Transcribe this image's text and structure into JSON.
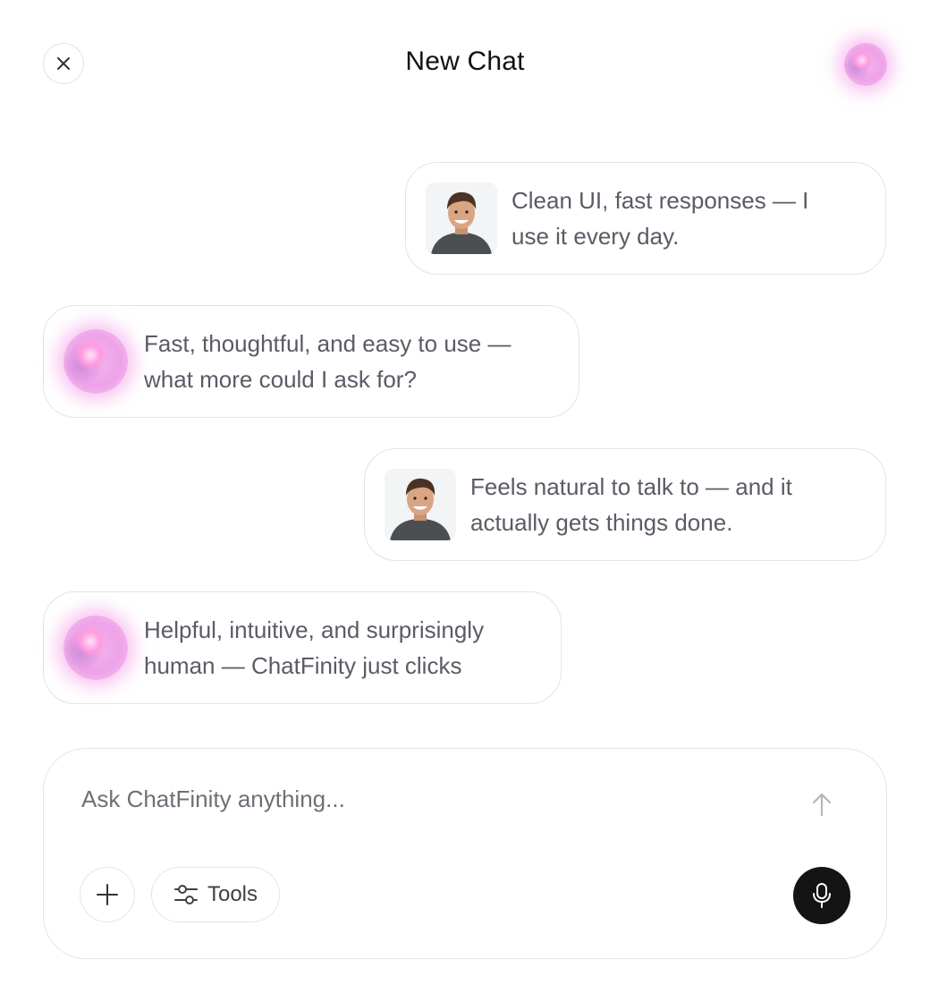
{
  "header": {
    "title": "New Chat",
    "close_icon": "close-icon",
    "assistant_icon": "assistant-orb-icon"
  },
  "messages": [
    {
      "role": "user",
      "text": "Clean UI, fast responses — I use it every day."
    },
    {
      "role": "assistant",
      "text": "Fast, thoughtful, and easy to use — what more could I ask for?"
    },
    {
      "role": "user",
      "text": "Feels natural to talk to — and it actually gets things done."
    },
    {
      "role": "assistant",
      "text": "Helpful, intuitive, and surprisingly human — ChatFinity just clicks"
    }
  ],
  "composer": {
    "placeholder": "Ask ChatFinity anything...",
    "value": "",
    "tools_label": "Tools",
    "icons": {
      "send": "arrow-up-icon",
      "add": "plus-icon",
      "tools": "sliders-icon",
      "mic": "microphone-icon"
    }
  },
  "colors": {
    "border": "#e4e4e7",
    "message_text": "#5b5b66",
    "orb_pink": "#f4b4ee",
    "mic_bg": "#141414"
  }
}
